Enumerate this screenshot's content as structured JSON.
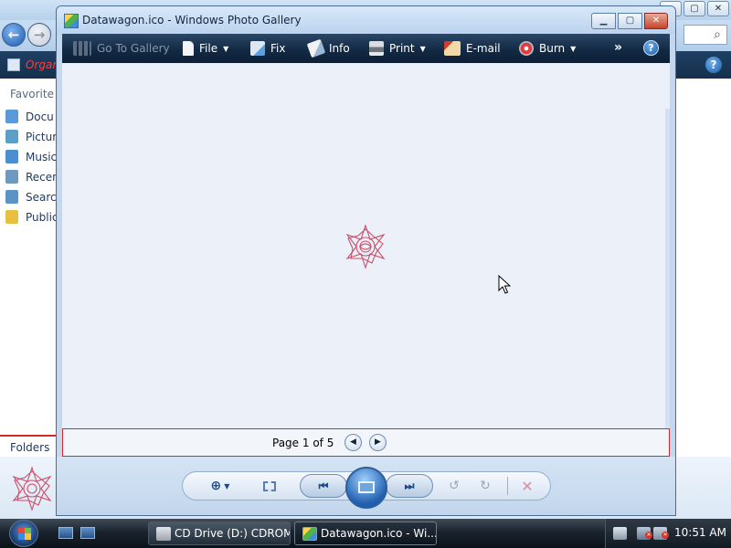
{
  "background_window": {
    "organize_label": "Organi",
    "search_glyph": "⌕",
    "favorites_header": "Favorite L",
    "favorites": [
      {
        "label": "Docu",
        "icon": "documents-folder-icon",
        "color": "#5a9ad8"
      },
      {
        "label": "Pictur",
        "icon": "pictures-folder-icon",
        "color": "#5aa0c8"
      },
      {
        "label": "Music",
        "icon": "music-folder-icon",
        "color": "#4a8fcf"
      },
      {
        "label": "Recen",
        "icon": "recent-folder-icon",
        "color": "#6f9ac0"
      },
      {
        "label": "Search",
        "icon": "searches-folder-icon",
        "color": "#5c93c6"
      },
      {
        "label": "Public",
        "icon": "public-folder-icon",
        "color": "#e8c040"
      }
    ],
    "folders_label": "Folders"
  },
  "gallery": {
    "title": "Datawagon.ico - Windows Photo Gallery",
    "toolbar": {
      "goto_gallery": "Go To Gallery",
      "file": "File",
      "fix": "Fix",
      "info": "Info",
      "print": "Print",
      "email": "E-mail",
      "burn": "Burn",
      "overflow": "»",
      "help": "?"
    },
    "page_label": "Page 1 of 5",
    "caption_buttons": {
      "minimize": "▁",
      "maximize": "▢",
      "close": "✕"
    },
    "controls": {
      "zoom": "⊕",
      "prev": "⏮",
      "next": "⏭",
      "rotate_left": "↺",
      "rotate_right": "↻",
      "delete": "✕"
    }
  },
  "taskbar": {
    "buttons": [
      {
        "label": "CD Drive (D:) CDROM",
        "active": false
      },
      {
        "label": "Datawagon.ico - Wi...",
        "active": true
      }
    ],
    "clock": "10:51 AM"
  },
  "colors": {
    "accent_red": "#d22a2a",
    "toolbar_dark": "#132a44",
    "viewer_bg": "#ecf1f9",
    "icon_pink": "#c9506a"
  }
}
